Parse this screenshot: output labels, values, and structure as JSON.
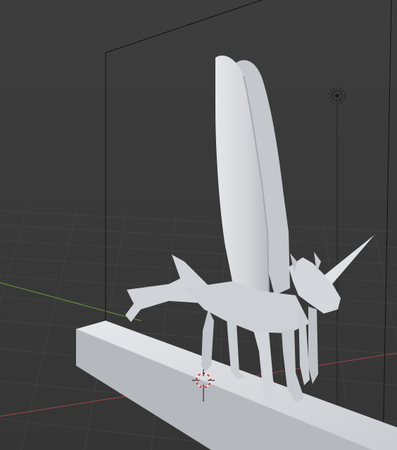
{
  "editor": "3d-viewport",
  "shading": "solid",
  "scene_objects": [
    "unicorn-sculpture",
    "base-plinth",
    "camera-frame",
    "light",
    "3d-cursor"
  ],
  "colors": {
    "background": "#3a3a3a",
    "grid_line": "#424242",
    "x_axis": "#a0454a",
    "y_axis": "#6a9a3a",
    "object_fill": "#d6d8db",
    "object_shadow": "#a9acb1",
    "camera_outline": "#111111",
    "cursor_red": "#d03c3c"
  }
}
